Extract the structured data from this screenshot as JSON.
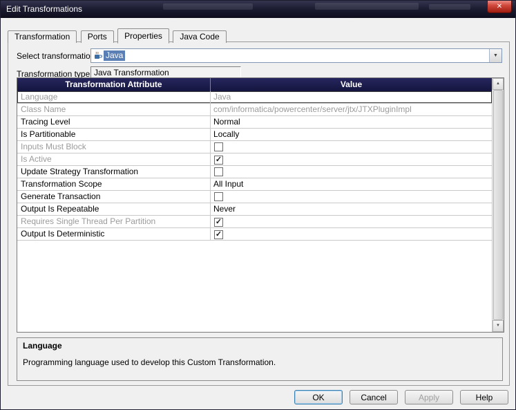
{
  "window": {
    "title": "Edit Transformations"
  },
  "icons": {
    "close": "✕",
    "combo_arrow": "▼",
    "up": "▲",
    "down": "▼",
    "check": "✓"
  },
  "tabs": [
    {
      "label": "Transformation",
      "active": false
    },
    {
      "label": "Ports",
      "active": false
    },
    {
      "label": "Properties",
      "active": true
    },
    {
      "label": "Java Code",
      "active": false
    }
  ],
  "form": {
    "select_transformation_label": "Select transformation:",
    "select_transformation_value": "Java",
    "transformation_type_label": "Transformation type:",
    "transformation_type_value": "Java Transformation"
  },
  "table": {
    "headers": [
      "Transformation Attribute",
      "Value"
    ],
    "rows": [
      {
        "attribute": "Language",
        "value": "Java",
        "type": "text",
        "disabled": true,
        "selected": true
      },
      {
        "attribute": "Class Name",
        "value": "com/informatica/powercenter/server/jtx/JTXPluginImpl",
        "type": "text",
        "disabled": true,
        "selected": false
      },
      {
        "attribute": "Tracing Level",
        "value": "Normal",
        "type": "text",
        "disabled": false,
        "selected": false
      },
      {
        "attribute": "Is Partitionable",
        "value": "Locally",
        "type": "text",
        "disabled": false,
        "selected": false
      },
      {
        "attribute": "Inputs Must Block",
        "value": false,
        "type": "checkbox",
        "disabled": true,
        "selected": false
      },
      {
        "attribute": "Is Active",
        "value": true,
        "type": "checkbox",
        "disabled": true,
        "selected": false
      },
      {
        "attribute": "Update Strategy Transformation",
        "value": false,
        "type": "checkbox",
        "disabled": false,
        "selected": false
      },
      {
        "attribute": "Transformation Scope",
        "value": "All Input",
        "type": "text",
        "disabled": false,
        "selected": false
      },
      {
        "attribute": "Generate Transaction",
        "value": false,
        "type": "checkbox",
        "disabled": false,
        "selected": false
      },
      {
        "attribute": "Output Is Repeatable",
        "value": "Never",
        "type": "text",
        "disabled": false,
        "selected": false
      },
      {
        "attribute": "Requires Single Thread Per Partition",
        "value": true,
        "type": "checkbox",
        "disabled": true,
        "selected": false
      },
      {
        "attribute": "Output Is Deterministic",
        "value": true,
        "type": "checkbox",
        "disabled": false,
        "selected": false
      }
    ]
  },
  "description": {
    "title": "Language",
    "text": "Programming language used to develop this Custom Transformation."
  },
  "buttons": [
    {
      "label": "OK",
      "disabled": false,
      "default": true
    },
    {
      "label": "Cancel",
      "disabled": false,
      "default": false
    },
    {
      "label": "Apply",
      "disabled": true,
      "default": false
    },
    {
      "label": "Help",
      "disabled": false,
      "default": false
    }
  ],
  "colors": {
    "grid_header_bg": "#1b1b4d",
    "selection_bg": "#5a7fb5",
    "titlebar_bg": "#1d1d33",
    "close_button": "#b5281a"
  }
}
